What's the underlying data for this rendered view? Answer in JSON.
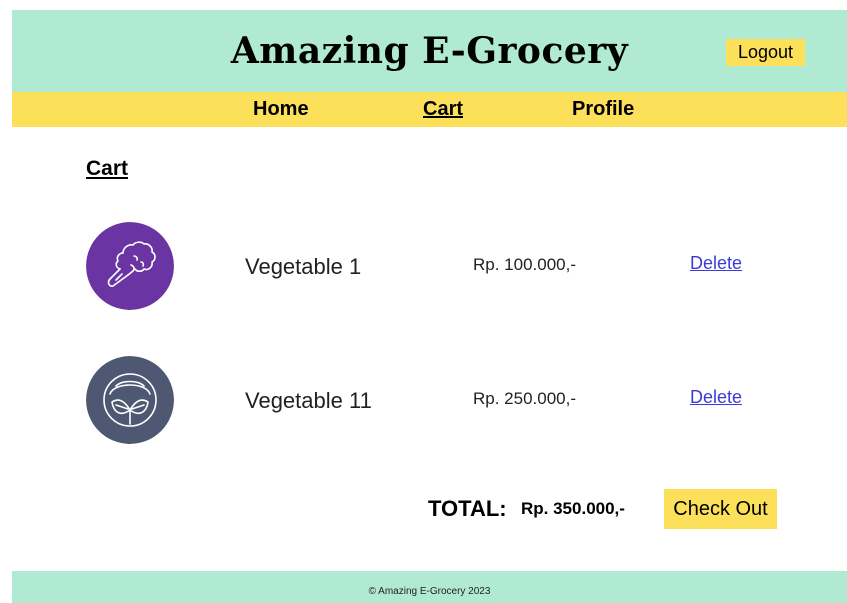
{
  "header": {
    "title": "Amazing E-Grocery",
    "logout_label": "Logout"
  },
  "nav": {
    "items": [
      {
        "label": "Home",
        "active": false
      },
      {
        "label": "Cart",
        "active": true
      },
      {
        "label": "Profile",
        "active": false
      }
    ]
  },
  "cart": {
    "heading": "Cart",
    "items": [
      {
        "name": "Vegetable 1",
        "price": "Rp. 100.000,-",
        "delete_label": "Delete",
        "icon": "broccoli-icon",
        "icon_bg": "#6a35a3"
      },
      {
        "name": "Vegetable 11",
        "price": "Rp. 250.000,-",
        "delete_label": "Delete",
        "icon": "cabbage-icon",
        "icon_bg": "#4f5872"
      }
    ],
    "total_label": "TOTAL:",
    "total_value": "Rp. 350.000,-",
    "checkout_label": "Check Out"
  },
  "footer": {
    "text": "© Amazing E-Grocery 2023"
  },
  "colors": {
    "header_bg": "#b0ead2",
    "nav_bg": "#fde05a",
    "button_bg": "#fde05a",
    "link": "#3b3bd8"
  }
}
